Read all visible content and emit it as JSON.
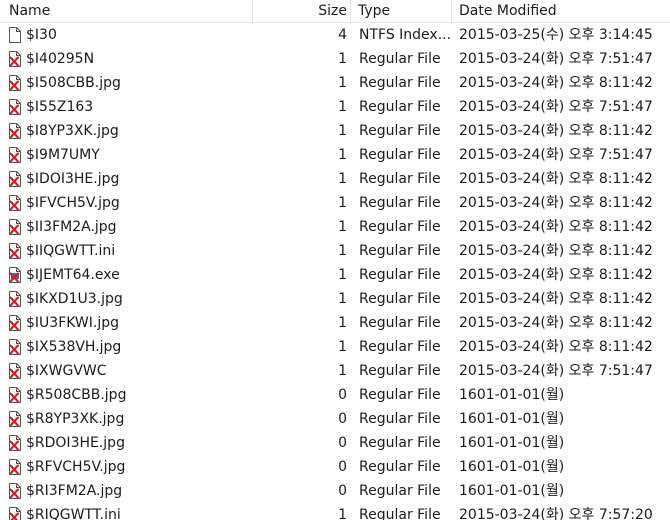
{
  "columns": {
    "name": "Name",
    "size": "Size",
    "type": "Type",
    "date": "Date Modified"
  },
  "rows": [
    {
      "name": "$I30",
      "size": "4",
      "type": "NTFS Index...",
      "date": "2015-03-25(수) 오후 3:14:45",
      "icon": "file-icon"
    },
    {
      "name": "$I40295N",
      "size": "1",
      "type": "Regular File",
      "date": "2015-03-24(화) 오후 7:51:47",
      "icon": "deleted-file-icon"
    },
    {
      "name": "$I508CBB.jpg",
      "size": "1",
      "type": "Regular File",
      "date": "2015-03-24(화) 오후 8:11:42",
      "icon": "deleted-file-icon"
    },
    {
      "name": "$I55Z163",
      "size": "1",
      "type": "Regular File",
      "date": "2015-03-24(화) 오후 7:51:47",
      "icon": "deleted-file-icon"
    },
    {
      "name": "$I8YP3XK.jpg",
      "size": "1",
      "type": "Regular File",
      "date": "2015-03-24(화) 오후 8:11:42",
      "icon": "deleted-file-icon"
    },
    {
      "name": "$I9M7UMY",
      "size": "1",
      "type": "Regular File",
      "date": "2015-03-24(화) 오후 7:51:47",
      "icon": "deleted-file-icon"
    },
    {
      "name": "$IDOI3HE.jpg",
      "size": "1",
      "type": "Regular File",
      "date": "2015-03-24(화) 오후 8:11:42",
      "icon": "deleted-file-icon"
    },
    {
      "name": "$IFVCH5V.jpg",
      "size": "1",
      "type": "Regular File",
      "date": "2015-03-24(화) 오후 8:11:42",
      "icon": "deleted-file-icon"
    },
    {
      "name": "$II3FM2A.jpg",
      "size": "1",
      "type": "Regular File",
      "date": "2015-03-24(화) 오후 8:11:42",
      "icon": "deleted-file-icon"
    },
    {
      "name": "$IIQGWTT.ini",
      "size": "1",
      "type": "Regular File",
      "date": "2015-03-24(화) 오후 8:11:42",
      "icon": "deleted-file-icon"
    },
    {
      "name": "$IJEMT64.exe",
      "size": "1",
      "type": "Regular File",
      "date": "2015-03-24(화) 오후 8:11:42",
      "icon": "deleted-exe-icon"
    },
    {
      "name": "$IKXD1U3.jpg",
      "size": "1",
      "type": "Regular File",
      "date": "2015-03-24(화) 오후 8:11:42",
      "icon": "deleted-file-icon"
    },
    {
      "name": "$IU3FKWI.jpg",
      "size": "1",
      "type": "Regular File",
      "date": "2015-03-24(화) 오후 8:11:42",
      "icon": "deleted-file-icon"
    },
    {
      "name": "$IX538VH.jpg",
      "size": "1",
      "type": "Regular File",
      "date": "2015-03-24(화) 오후 8:11:42",
      "icon": "deleted-file-icon"
    },
    {
      "name": "$IXWGVWC",
      "size": "1",
      "type": "Regular File",
      "date": "2015-03-24(화) 오후 7:51:47",
      "icon": "deleted-file-icon"
    },
    {
      "name": "$R508CBB.jpg",
      "size": "0",
      "type": "Regular File",
      "date": "1601-01-01(월)",
      "icon": "deleted-file-icon"
    },
    {
      "name": "$R8YP3XK.jpg",
      "size": "0",
      "type": "Regular File",
      "date": "1601-01-01(월)",
      "icon": "deleted-file-icon"
    },
    {
      "name": "$RDOI3HE.jpg",
      "size": "0",
      "type": "Regular File",
      "date": "1601-01-01(월)",
      "icon": "deleted-file-icon"
    },
    {
      "name": "$RFVCH5V.jpg",
      "size": "0",
      "type": "Regular File",
      "date": "1601-01-01(월)",
      "icon": "deleted-file-icon"
    },
    {
      "name": "$RI3FM2A.jpg",
      "size": "0",
      "type": "Regular File",
      "date": "1601-01-01(월)",
      "icon": "deleted-file-icon"
    },
    {
      "name": "$RIQGWTT.ini",
      "size": "1",
      "type": "Regular File",
      "date": "2015-03-24(화) 오후 7:57:20",
      "icon": "deleted-file-icon"
    }
  ],
  "colors": {
    "deleted_mark": "#d0202a",
    "file_outline": "#555555"
  }
}
